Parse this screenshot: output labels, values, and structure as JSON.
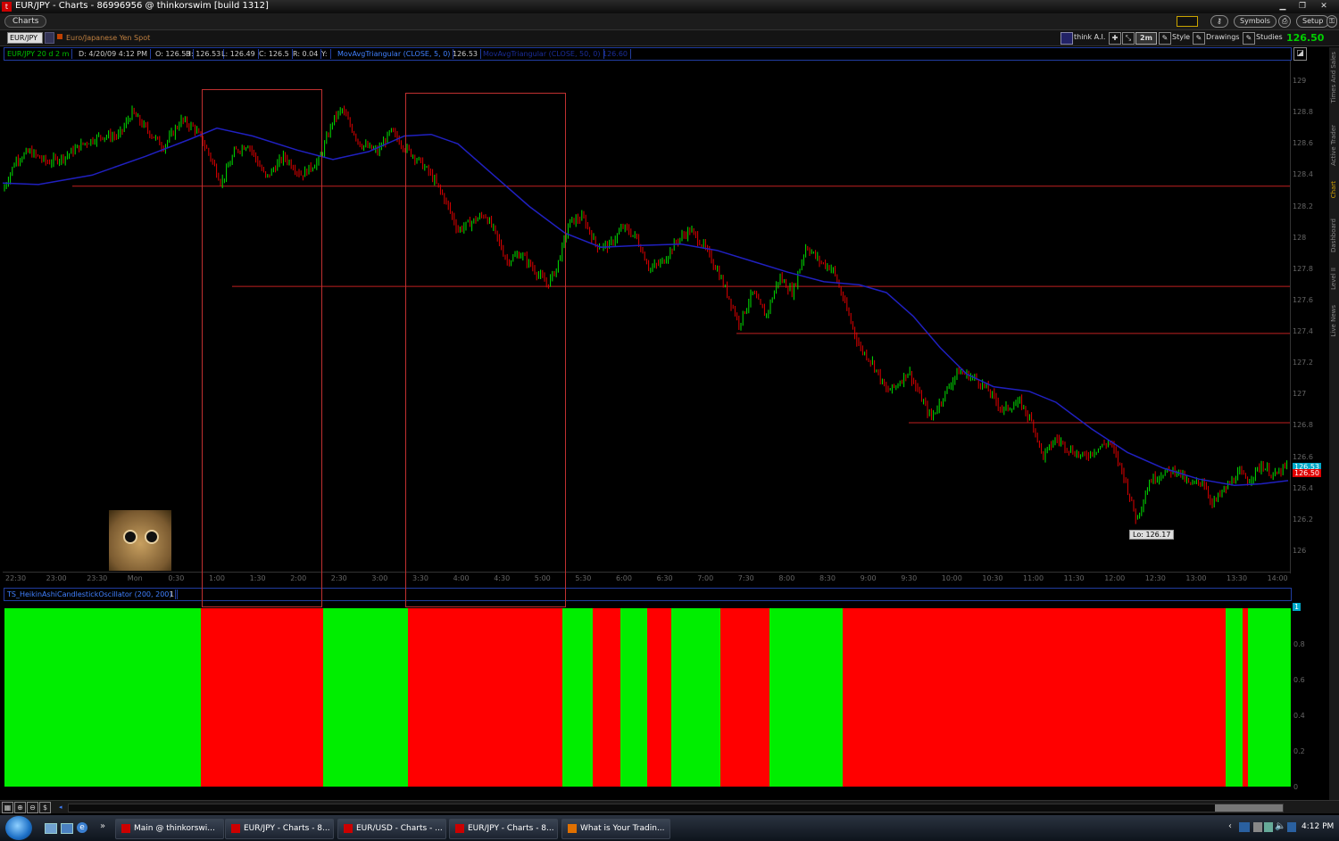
{
  "window": {
    "title": "EUR/JPY - Charts - 86996956 @ thinkorswim [build 1312]"
  },
  "menubar": {
    "charts_tab": "Charts",
    "symbols": "Symbols",
    "setup": "Setup"
  },
  "toolbar": {
    "symbol": "EUR/JPY",
    "description": "Euro/Japanese Yen Spot",
    "think_ai": "think A.I.",
    "timeframe": "2m",
    "style": "Style",
    "drawings": "Drawings",
    "studies": "Studies",
    "last_price": "126.50"
  },
  "infobar": {
    "symbol_period": "EUR/JPY 20 d 2 m",
    "date": "D: 4/20/09 4:12 PM",
    "open": "O: 126.53",
    "high": "H: 126.53",
    "low": "L: 126.49",
    "close": "C: 126.5",
    "range": "R: 0.04",
    "y": "Y:",
    "study1": "MovAvgTriangular (CLOSE, 5, 0)",
    "study1_value": "126.53",
    "study2": "MovAvgTriangular (CLOSE, 50, 0)",
    "study2_value": "126.60"
  },
  "oscillator": {
    "name": "TS_HeikinAshiCandlestickOscillator (200, 200)",
    "value": "1",
    "axis_badge": "1",
    "y_labels": [
      "0.8",
      "0.6",
      "0.4",
      "0.2",
      "0"
    ]
  },
  "price_axis": {
    "labels": [
      "129",
      "128.8",
      "128.6",
      "128.4",
      "128.2",
      "128",
      "127.8",
      "127.6",
      "127.4",
      "127.2",
      "127",
      "126.8",
      "126.6",
      "126.4",
      "126.2",
      "126"
    ],
    "badge_ma": "126.53",
    "badge_last": "126.50"
  },
  "time_axis": {
    "labels": [
      "22:30",
      "23:00",
      "23:30",
      "Mon",
      "0:30",
      "1:00",
      "1:30",
      "2:00",
      "2:30",
      "3:00",
      "3:30",
      "4:00",
      "4:30",
      "5:00",
      "5:30",
      "6:00",
      "6:30",
      "7:00",
      "7:30",
      "8:00",
      "8:30",
      "9:00",
      "9:30",
      "10:00",
      "10:30",
      "11:00",
      "11:30",
      "12:00",
      "12:30",
      "13:00",
      "13:30",
      "14:00"
    ]
  },
  "annotations": {
    "low_label": "Lo: 126.17"
  },
  "right_tabs": [
    "Times And Sales",
    "Active Trader",
    "Chart",
    "Dashboard",
    "Level II",
    "Live News"
  ],
  "taskbar": {
    "tasks": [
      "Main @ thinkorswi...",
      "EUR/JPY - Charts - 8...",
      "EUR/USD - Charts - ...",
      "EUR/JPY - Charts - 8...",
      "What is Your Tradin..."
    ],
    "clock": "4:12 PM"
  },
  "colors": {
    "up": "#00e000",
    "down": "#e00000",
    "ma": "#2020c0",
    "grid_line": "#c02020"
  },
  "chart_data": {
    "type": "candlestick",
    "title": "",
    "y_range": [
      125.9,
      129.1
    ],
    "price_lines": [
      128.33,
      127.69,
      127.39,
      126.82
    ],
    "low_value": 126.17,
    "ma_path": [
      [
        0,
        128.35
      ],
      [
        40,
        128.34
      ],
      [
        100,
        128.4
      ],
      [
        160,
        128.52
      ],
      [
        210,
        128.63
      ],
      [
        240,
        128.7
      ],
      [
        280,
        128.65
      ],
      [
        330,
        128.56
      ],
      [
        370,
        128.5
      ],
      [
        410,
        128.55
      ],
      [
        450,
        128.65
      ],
      [
        480,
        128.66
      ],
      [
        510,
        128.6
      ],
      [
        550,
        128.4
      ],
      [
        590,
        128.2
      ],
      [
        630,
        128.03
      ],
      [
        670,
        127.94
      ],
      [
        710,
        127.95
      ],
      [
        760,
        127.96
      ],
      [
        800,
        127.92
      ],
      [
        840,
        127.85
      ],
      [
        880,
        127.78
      ],
      [
        920,
        127.72
      ],
      [
        960,
        127.7
      ],
      [
        990,
        127.65
      ],
      [
        1020,
        127.5
      ],
      [
        1050,
        127.3
      ],
      [
        1080,
        127.13
      ],
      [
        1110,
        127.05
      ],
      [
        1150,
        127.02
      ],
      [
        1180,
        126.95
      ],
      [
        1220,
        126.78
      ],
      [
        1260,
        126.63
      ],
      [
        1300,
        126.53
      ],
      [
        1340,
        126.46
      ],
      [
        1380,
        126.42
      ],
      [
        1410,
        126.43
      ],
      [
        1440,
        126.45
      ]
    ],
    "price_path": [
      [
        0,
        128.3
      ],
      [
        15,
        128.5
      ],
      [
        30,
        128.55
      ],
      [
        50,
        128.48
      ],
      [
        70,
        128.52
      ],
      [
        90,
        128.6
      ],
      [
        110,
        128.65
      ],
      [
        130,
        128.65
      ],
      [
        145,
        128.8
      ],
      [
        160,
        128.7
      ],
      [
        180,
        128.58
      ],
      [
        200,
        128.75
      ],
      [
        215,
        128.7
      ],
      [
        230,
        128.55
      ],
      [
        245,
        128.35
      ],
      [
        260,
        128.55
      ],
      [
        275,
        128.6
      ],
      [
        295,
        128.38
      ],
      [
        315,
        128.52
      ],
      [
        335,
        128.4
      ],
      [
        355,
        128.5
      ],
      [
        370,
        128.75
      ],
      [
        380,
        128.82
      ],
      [
        400,
        128.6
      ],
      [
        420,
        128.55
      ],
      [
        435,
        128.68
      ],
      [
        450,
        128.58
      ],
      [
        465,
        128.5
      ],
      [
        480,
        128.4
      ],
      [
        495,
        128.25
      ],
      [
        510,
        128.05
      ],
      [
        525,
        128.1
      ],
      [
        540,
        128.15
      ],
      [
        550,
        128.05
      ],
      [
        565,
        127.85
      ],
      [
        580,
        127.9
      ],
      [
        595,
        127.8
      ],
      [
        610,
        127.7
      ],
      [
        620,
        127.8
      ],
      [
        635,
        128.1
      ],
      [
        650,
        128.13
      ],
      [
        665,
        127.95
      ],
      [
        680,
        127.95
      ],
      [
        695,
        128.07
      ],
      [
        710,
        128
      ],
      [
        725,
        127.8
      ],
      [
        740,
        127.85
      ],
      [
        755,
        127.98
      ],
      [
        770,
        128.05
      ],
      [
        785,
        127.95
      ],
      [
        800,
        127.8
      ],
      [
        815,
        127.6
      ],
      [
        825,
        127.45
      ],
      [
        840,
        127.65
      ],
      [
        855,
        127.5
      ],
      [
        870,
        127.75
      ],
      [
        885,
        127.65
      ],
      [
        900,
        127.95
      ],
      [
        915,
        127.85
      ],
      [
        930,
        127.8
      ],
      [
        945,
        127.55
      ],
      [
        960,
        127.3
      ],
      [
        975,
        127.2
      ],
      [
        990,
        127.02
      ],
      [
        1000,
        127.05
      ],
      [
        1015,
        127.15
      ],
      [
        1025,
        127.02
      ],
      [
        1040,
        126.85
      ],
      [
        1055,
        127.0
      ],
      [
        1070,
        127.15
      ],
      [
        1090,
        127.1
      ],
      [
        1105,
        127.02
      ],
      [
        1120,
        126.9
      ],
      [
        1140,
        126.95
      ],
      [
        1155,
        126.8
      ],
      [
        1165,
        126.6
      ],
      [
        1180,
        126.72
      ],
      [
        1195,
        126.65
      ],
      [
        1210,
        126.6
      ],
      [
        1225,
        126.65
      ],
      [
        1240,
        126.7
      ],
      [
        1255,
        126.5
      ],
      [
        1270,
        126.2
      ],
      [
        1285,
        126.45
      ],
      [
        1300,
        126.5
      ],
      [
        1315,
        126.52
      ],
      [
        1330,
        126.42
      ],
      [
        1345,
        126.45
      ],
      [
        1355,
        126.3
      ],
      [
        1370,
        126.4
      ],
      [
        1385,
        126.5
      ],
      [
        1395,
        126.45
      ],
      [
        1410,
        126.55
      ],
      [
        1425,
        126.48
      ],
      [
        1440,
        126.55
      ]
    ],
    "highlight_boxes": [
      {
        "t_start": "1:00",
        "t_end": "2:30"
      },
      {
        "t_start": "3:30",
        "t_end": "5:30"
      }
    ],
    "oscillator_segments": [
      {
        "x0": 0,
        "x1": 220,
        "state": "up"
      },
      {
        "x0": 220,
        "x1": 357,
        "state": "down"
      },
      {
        "x0": 357,
        "x1": 452,
        "state": "up"
      },
      {
        "x0": 452,
        "x1": 625,
        "state": "down"
      },
      {
        "x0": 625,
        "x1": 659,
        "state": "up"
      },
      {
        "x0": 659,
        "x1": 690,
        "state": "down"
      },
      {
        "x0": 690,
        "x1": 720,
        "state": "up"
      },
      {
        "x0": 720,
        "x1": 747,
        "state": "down"
      },
      {
        "x0": 747,
        "x1": 802,
        "state": "up"
      },
      {
        "x0": 802,
        "x1": 857,
        "state": "down"
      },
      {
        "x0": 857,
        "x1": 939,
        "state": "up"
      },
      {
        "x0": 939,
        "x1": 1368,
        "state": "down"
      },
      {
        "x0": 1368,
        "x1": 1387,
        "state": "up"
      },
      {
        "x0": 1387,
        "x1": 1393,
        "state": "down"
      },
      {
        "x0": 1393,
        "x1": 1442,
        "state": "up"
      }
    ]
  }
}
